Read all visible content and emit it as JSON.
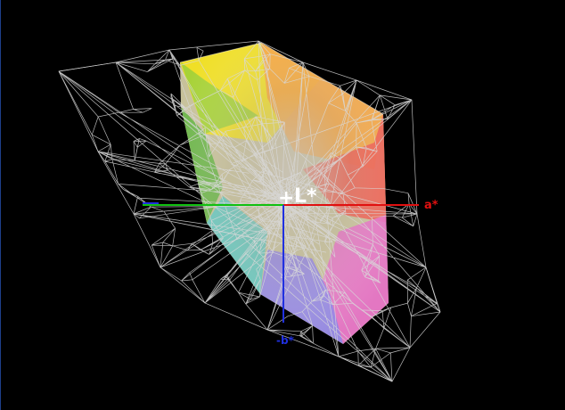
{
  "axes": {
    "l_label": "L*",
    "a_label": "a*",
    "b_label": "-b*",
    "plus_sign": "+",
    "colors": {
      "a_positive": "#e01010",
      "a_negative": "#10c010",
      "b_axis": "#2030e0",
      "l_label": "#ffffff"
    }
  },
  "mesh": {
    "color": "#d8d8d8",
    "background": "#000000"
  },
  "gamut_solid": {
    "colors": [
      "#f4e21a",
      "#f7a33c",
      "#ef5a4c",
      "#e56fc6",
      "#8f83e8",
      "#5cc6c0",
      "#62b440",
      "#9fd03a"
    ]
  }
}
